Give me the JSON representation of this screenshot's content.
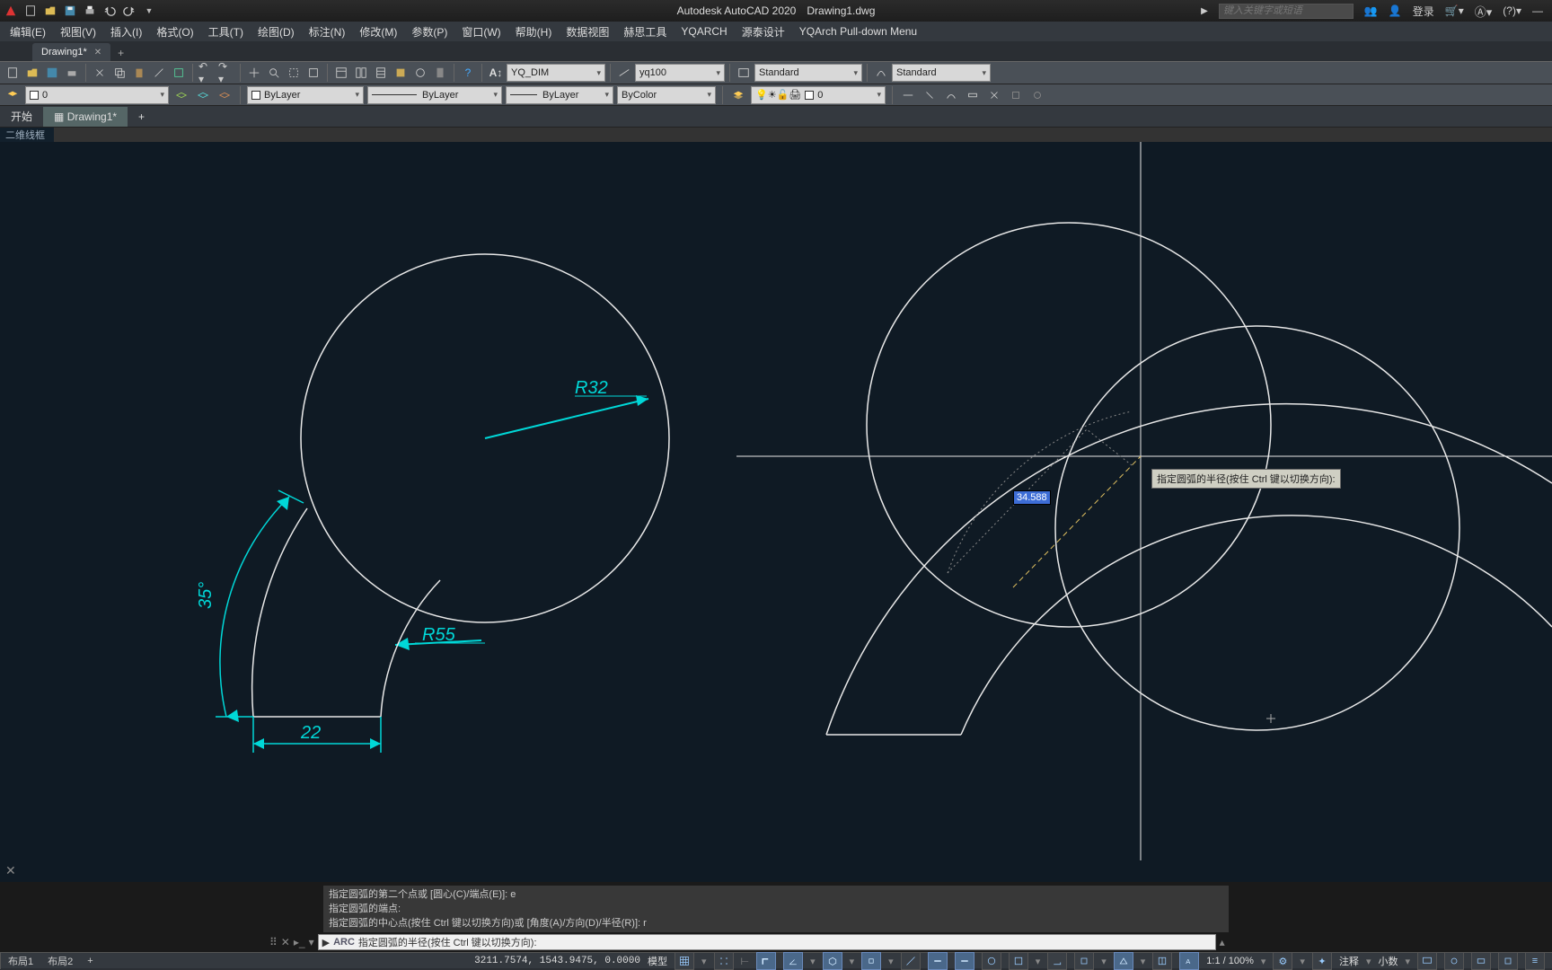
{
  "app": {
    "name": "Autodesk AutoCAD 2020",
    "file": "Drawing1.dwg"
  },
  "search_placeholder": "键入关键字或短语",
  "login_label": "登录",
  "menus": [
    "编辑(E)",
    "视图(V)",
    "插入(I)",
    "格式(O)",
    "工具(T)",
    "绘图(D)",
    "标注(N)",
    "修改(M)",
    "参数(P)",
    "窗口(W)",
    "帮助(H)",
    "数据视图",
    "赫思工具",
    "YQARCH",
    "源泰设计",
    "YQArch Pull-down Menu"
  ],
  "filetab": {
    "name": "Drawing1*",
    "plus": "+"
  },
  "ribbon_tabs": {
    "start": "开始",
    "active": "Drawing1*",
    "plus": "+"
  },
  "panel_label": "二维线框",
  "toolbar": {
    "text_style": "YQ_DIM",
    "dim_style": "yq100",
    "table_style": "Standard",
    "ml_style": "Standard"
  },
  "props": {
    "layer_value": "0",
    "color": "ByLayer",
    "linetype": "ByLayer",
    "lineweight": "ByLayer",
    "plotstyle": "ByColor",
    "layer_state": "0"
  },
  "drawing": {
    "r32": "R32",
    "r55": "R55",
    "ang35": "35°",
    "dim22": "22",
    "dyn_value": "34.588",
    "tooltip": "指定圆弧的半径(按住 Ctrl 键以切换方向):"
  },
  "cmd": {
    "hist1": "指定圆弧的第二个点或 [圆心(C)/端点(E)]: e",
    "hist2": "指定圆弧的端点:",
    "hist3": "指定圆弧的中心点(按住 Ctrl 键以切换方向)或 [角度(A)/方向(D)/半径(R)]: r",
    "prefix": "ARC",
    "prompt": "指定圆弧的半径(按住 Ctrl 键以切换方向):"
  },
  "sheets": {
    "layout1": "布局1",
    "layout2": "布局2",
    "plus": "+"
  },
  "status": {
    "coords": "3211.7574, 1543.9475, 0.0000",
    "model": "模型",
    "scale": "1:1 / 100%",
    "decimal": "小数",
    "annot": "注释"
  }
}
